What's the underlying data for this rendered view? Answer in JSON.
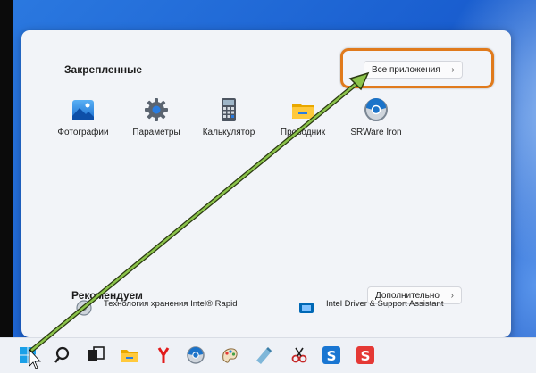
{
  "start_menu": {
    "pinned_title": "Закрепленные",
    "all_apps_button": "Все приложения",
    "pinned_apps": [
      {
        "label": "Фотографии",
        "icon": "photos-icon"
      },
      {
        "label": "Параметры",
        "icon": "settings-gear-icon"
      },
      {
        "label": "Калькулятор",
        "icon": "calculator-icon"
      },
      {
        "label": "Проводник",
        "icon": "file-explorer-folder-icon"
      },
      {
        "label": "SRWare Iron",
        "icon": "srware-iron-icon"
      }
    ],
    "recommended_title": "Рекомендуем",
    "more_button": "Дополнительно",
    "recommended_items": [
      {
        "title": "Технология хранения Intel® Rapid",
        "icon": "intel-rapid-storage-icon"
      },
      {
        "title": "Intel Driver & Support Assistant",
        "icon": "intel-driver-assistant-icon"
      }
    ]
  },
  "taskbar": {
    "icons": [
      "windows-start-icon",
      "search-icon",
      "task-view-icon",
      "file-explorer-icon",
      "yandex-browser-icon",
      "srware-iron-icon",
      "paint-icon",
      "notepad-icon",
      "snipping-tool-icon",
      "app-s-blue-icon",
      "app-s-red-icon"
    ]
  },
  "colors": {
    "highlight": "#e07a1c",
    "arrow": "#7cb342",
    "menu_background": "#f2f4f8",
    "accent": "#0078d4"
  }
}
